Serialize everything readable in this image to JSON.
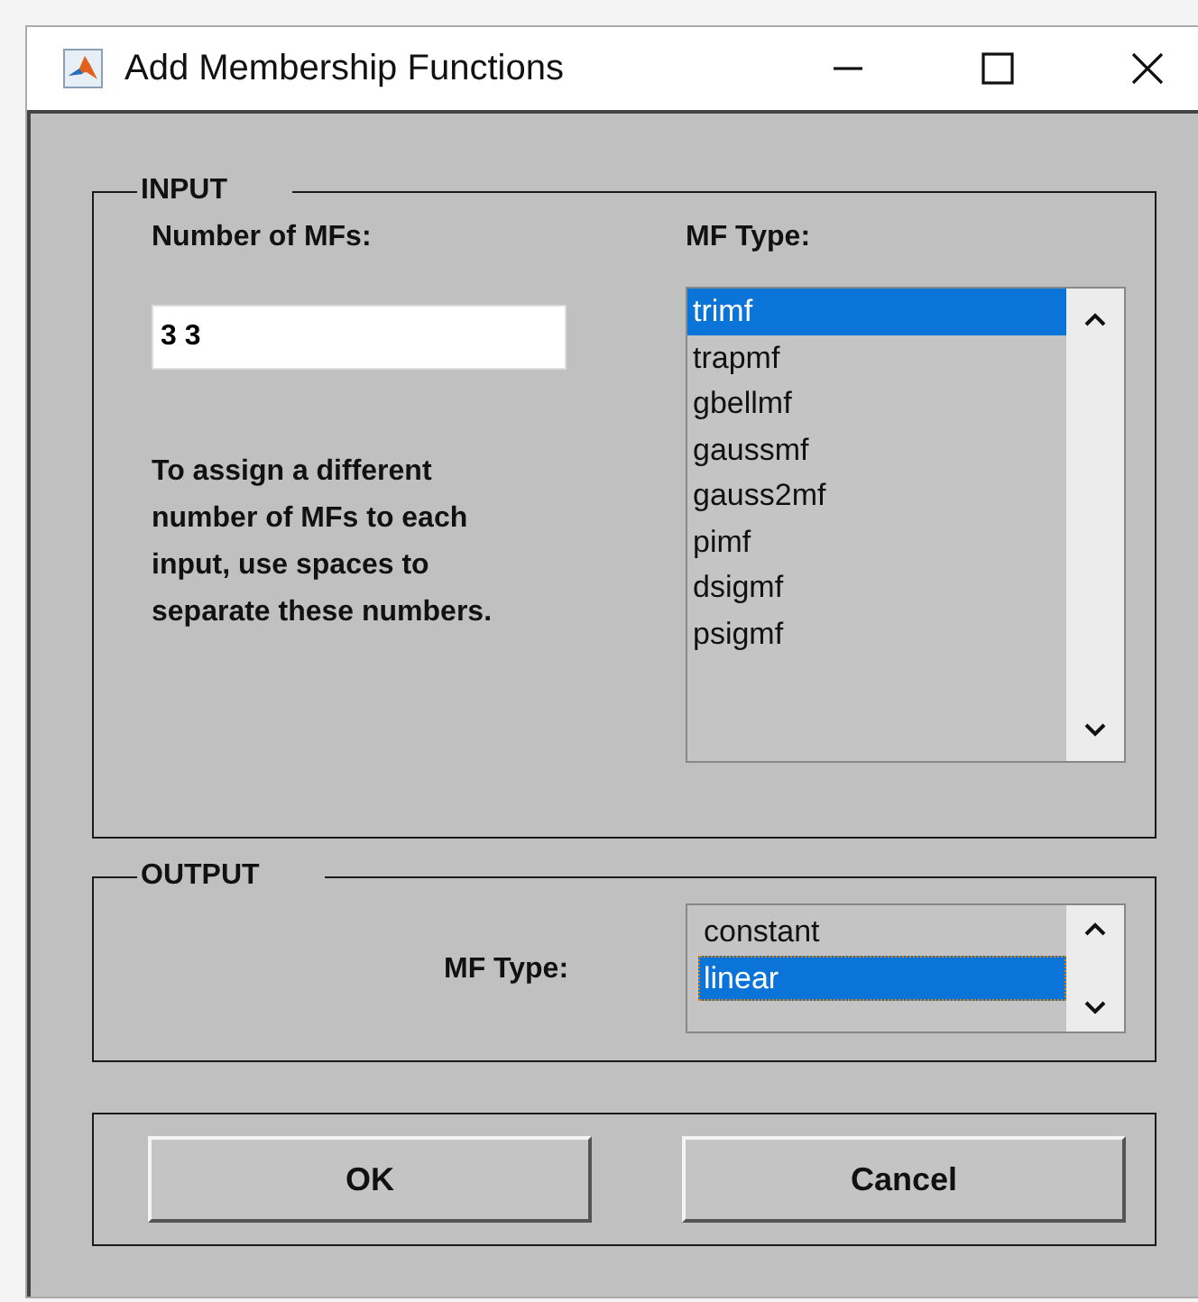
{
  "window": {
    "title": "Add Membership Functions"
  },
  "input": {
    "title": "INPUT",
    "count_label": "Number of MFs:",
    "count_field": {
      "value": "3 3"
    },
    "help": "To assign a different number of MFs to each input, use spaces to separate these numbers.",
    "type_label": "MF Type:",
    "type_list": [
      {
        "label": "trimf",
        "selected": true
      },
      {
        "label": "trapmf",
        "selected": false
      },
      {
        "label": "gbellmf",
        "selected": false
      },
      {
        "label": "gaussmf",
        "selected": false
      },
      {
        "label": "gauss2mf",
        "selected": false
      },
      {
        "label": "pimf",
        "selected": false
      },
      {
        "label": "dsigmf",
        "selected": false
      },
      {
        "label": "psigmf",
        "selected": false
      }
    ]
  },
  "output": {
    "title": "OUTPUT",
    "type_label": "MF Type:",
    "type_list": [
      {
        "label": "constant",
        "selected": false
      },
      {
        "label": "linear",
        "selected": true
      }
    ]
  },
  "buttons": [
    "OK",
    "Cancel"
  ]
}
